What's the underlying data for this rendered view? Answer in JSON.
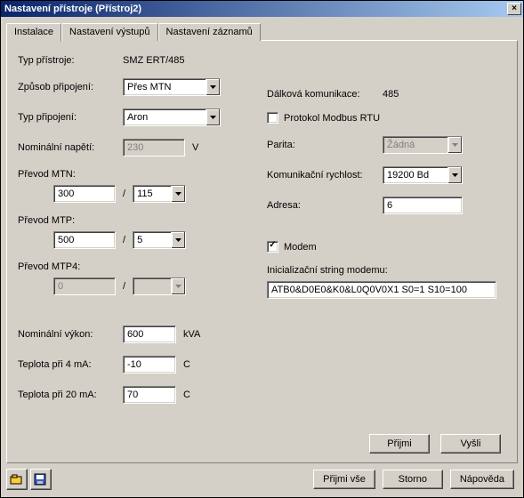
{
  "title": "Nastavení přístroje (Přístroj2)",
  "tabs": [
    {
      "label": "Instalace",
      "active": true
    },
    {
      "label": "Nastavení výstupů",
      "active": false
    },
    {
      "label": "Nastavení záznamů",
      "active": false
    }
  ],
  "left": {
    "device_type_label": "Typ přístroje:",
    "device_type_value": "SMZ ERT/485",
    "conn_method_label": "Způsob připojení:",
    "conn_method_value": "Přes MTN",
    "conn_type_label": "Typ připojení:",
    "conn_type_value": "Aron",
    "nom_voltage_label": "Nominální napětí:",
    "nom_voltage_value": "230",
    "nom_voltage_unit": "V",
    "mtn_label": "Převod MTN:",
    "mtn_a": "300",
    "mtn_b": "115",
    "mtp_label": "Převod MTP:",
    "mtp_a": "500",
    "mtp_b": "5",
    "mtp4_label": "Převod MTP4:",
    "mtp4_a": "0",
    "mtp4_b": "",
    "nom_power_label": "Nominální výkon:",
    "nom_power_value": "600",
    "nom_power_unit": "kVA",
    "t4_label": "Teplota při 4 mA:",
    "t4_value": "-10",
    "t4_unit": "C",
    "t20_label": "Teplota při 20 mA:",
    "t20_value": "70",
    "t20_unit": "C",
    "slash": "/"
  },
  "right": {
    "remote_comm_label": "Dálková komunikace:",
    "remote_comm_value": "485",
    "modbus_label": "Protokol Modbus RTU",
    "modbus_checked": false,
    "parity_label": "Parita:",
    "parity_value": "Žádná",
    "baud_label": "Komunikační rychlost:",
    "baud_value": "19200 Bd",
    "addr_label": "Adresa:",
    "addr_value": "6",
    "modem_label": "Modem",
    "modem_checked": true,
    "init_label": "Inicializační string modemu:",
    "init_value": "ATB0&D0E0&K0&L0Q0V0X1 S0=1 S10=100"
  },
  "panel_buttons": {
    "accept": "Přijmi",
    "send": "Vyšli"
  },
  "footer": {
    "accept_all": "Přijmi vše",
    "storno": "Storno",
    "help": "Nápověda"
  }
}
